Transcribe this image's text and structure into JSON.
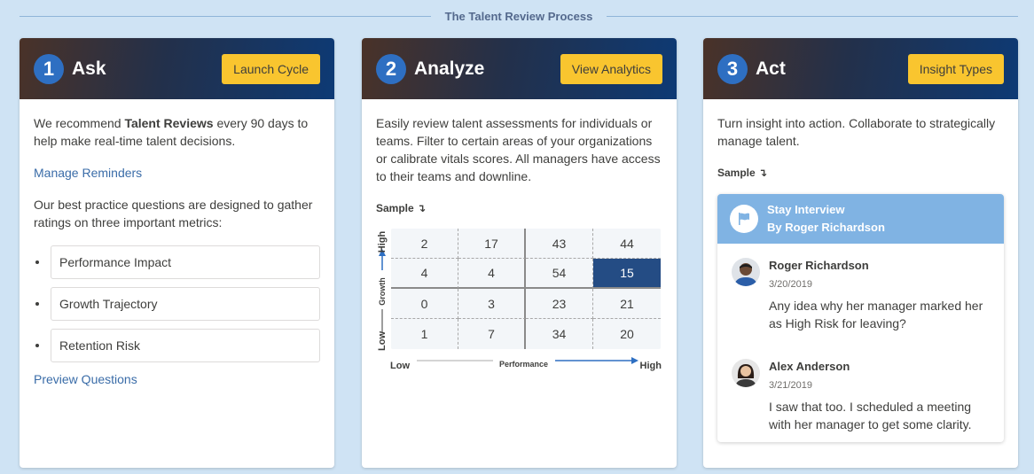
{
  "page": {
    "title": "The Talent Review Process"
  },
  "cards": [
    {
      "num": "1",
      "title": "Ask",
      "button": "Launch Cycle",
      "intro_pre": "We recommend ",
      "intro_bold": "Talent Reviews",
      "intro_post": " every 90 days to help make real-time talent decisions.",
      "link1": "Manage Reminders",
      "text2": "Our best practice questions are designed to gather ratings on three important metrics:",
      "questions": [
        "Performance Impact",
        "Growth Trajectory",
        "Retention Risk"
      ],
      "link2": "Preview Questions"
    },
    {
      "num": "2",
      "title": "Analyze",
      "button": "View Analytics",
      "text": "Easily review talent assessments for individuals or teams. Filter to certain areas of your organizations or calibrate vitals scores. All managers have access to their teams and downline.",
      "sample": "Sample ↴",
      "y_low": "Low",
      "y_mid": "Growth",
      "y_high": "High",
      "x_low": "Low",
      "x_mid": "Performance",
      "x_high": "High",
      "matrix": [
        [
          "2",
          "17",
          "43",
          "44"
        ],
        [
          "4",
          "4",
          "54",
          "15"
        ],
        [
          "0",
          "3",
          "23",
          "21"
        ],
        [
          "1",
          "7",
          "34",
          "20"
        ]
      ]
    },
    {
      "num": "3",
      "title": "Act",
      "button": "Insight Types",
      "text": "Turn insight into action. Collaborate to strategically manage talent.",
      "sample": "Sample ↴",
      "convo_title": "Stay Interview",
      "convo_sub": "By Roger Richardson",
      "messages": [
        {
          "name": "Roger Richardson",
          "date": "3/20/2019",
          "text": "Any idea why her manager marked her as High Risk for leaving?"
        },
        {
          "name": "Alex Anderson",
          "date": "3/21/2019",
          "text": "I saw that too. I scheduled a meeting with her manager to get some clarity."
        }
      ]
    }
  ],
  "colors": {
    "accent": "#f9c52f",
    "highlight": "#244c84",
    "step": "#2e6fc2",
    "link": "#3a6ca8",
    "convo_head": "#80b3e3"
  }
}
